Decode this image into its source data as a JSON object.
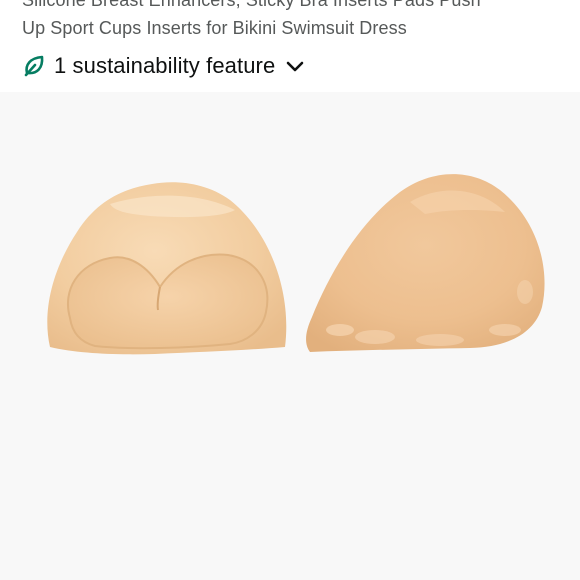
{
  "product": {
    "title_line_1": "Silicone Breast Enhancers, Sticky Bra Inserts Pads Push",
    "title_line_2": "Up Sport Cups Inserts for Bikini Swimsuit Dress"
  },
  "sustainability": {
    "label": "1 sustainability feature",
    "icon": "leaf-icon",
    "expand_icon": "chevron-down-icon",
    "accent_color": "#067d62"
  },
  "image": {
    "background_color": "#f8f8f8",
    "pad_color": "#f3cfa5"
  }
}
